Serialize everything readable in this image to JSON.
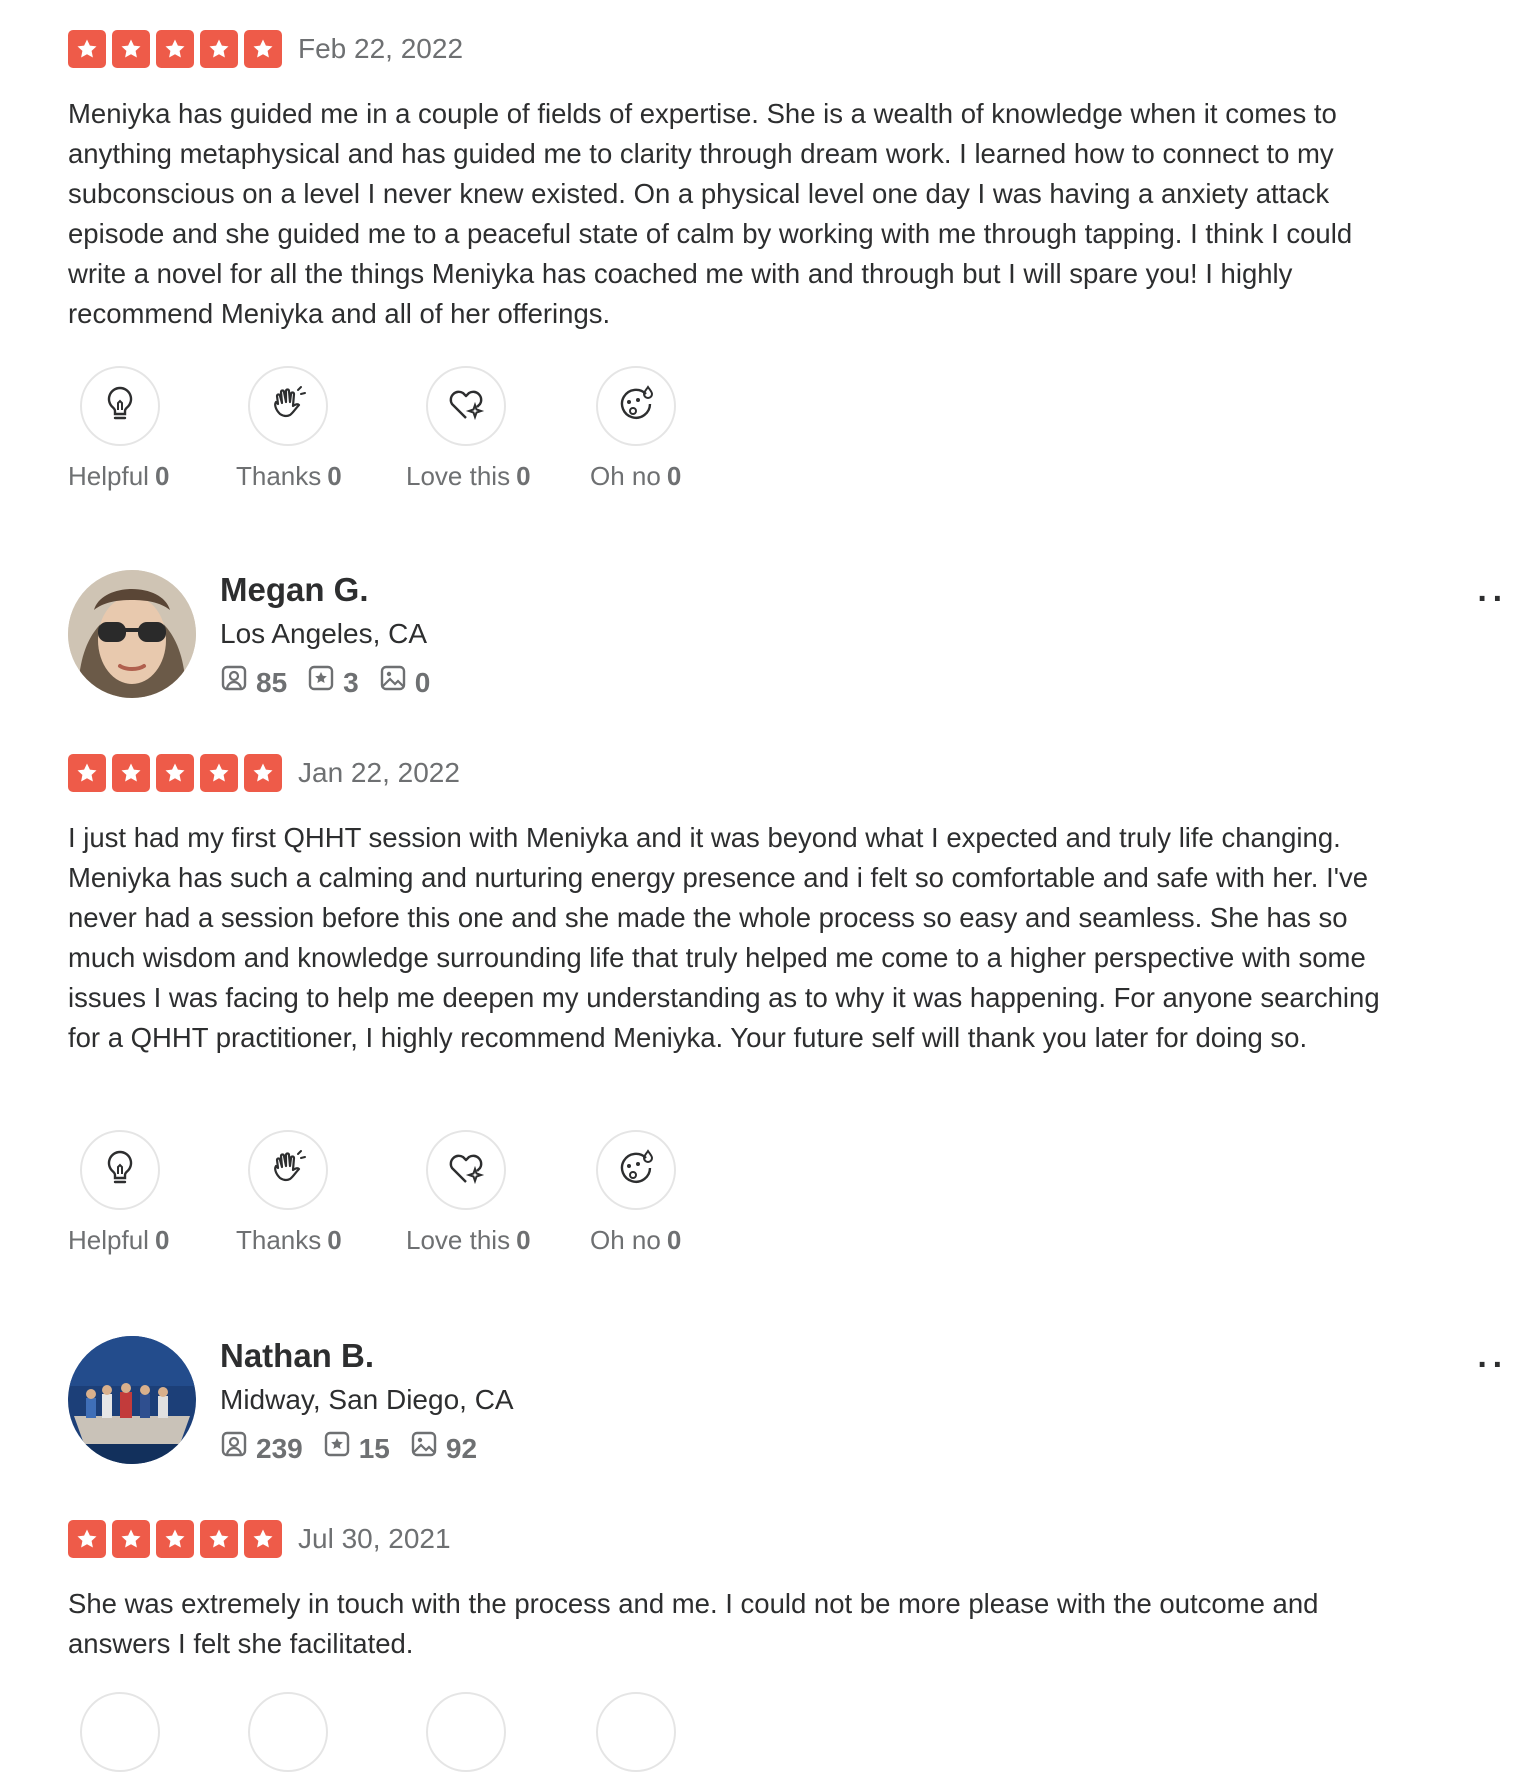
{
  "colors": {
    "star_red": "#ee5b49",
    "muted_text": "#6e7072",
    "body_text": "#2d2e2f",
    "circle_border": "#e5e5e5"
  },
  "reviews": [
    {
      "rating": 5,
      "date": "Feb 22, 2022",
      "text": "Meniyka has guided me in a couple of fields of expertise. She is a wealth of knowledge when it comes to anything metaphysical and has guided me to clarity through dream work. I learned how to connect to my subconscious on a level I never knew existed. On a physical level one day I was having a anxiety attack episode and she guided me to a peaceful state of calm by working with me through tapping. I think I could write a novel for all the things Meniyka has coached me with and through but I will spare you! I highly recommend Meniyka and all of her offerings.",
      "reactions": [
        {
          "label": "Helpful",
          "count": "0",
          "icon": "lightbulb-icon"
        },
        {
          "label": "Thanks",
          "count": "0",
          "icon": "wave-hand-icon"
        },
        {
          "label": "Love this",
          "count": "0",
          "icon": "heart-sparkle-icon"
        },
        {
          "label": "Oh no",
          "count": "0",
          "icon": "sad-face-icon"
        }
      ]
    },
    {
      "user": {
        "name": "Megan G.",
        "location": "Los Angeles, CA",
        "friends": "85",
        "reviews": "3",
        "photos": "0",
        "avatar": "avatar-sunglasses"
      },
      "more_label": "··",
      "rating": 5,
      "date": "Jan 22, 2022",
      "text": "I just had my first QHHT session with Meniyka and it was beyond what I expected and truly life changing. Meniyka has such a calming and nurturing energy presence and i felt so comfortable and safe with her. I've never had a session before this one and she made the whole process so easy and seamless. She has so much wisdom and knowledge surrounding life that truly helped me come to a higher perspective with some issues I was facing to help me deepen my understanding as to why it was happening. For anyone searching for a QHHT practitioner, I highly recommend Meniyka. Your future self will thank you later for doing so.",
      "reactions": [
        {
          "label": "Helpful",
          "count": "0",
          "icon": "lightbulb-icon"
        },
        {
          "label": "Thanks",
          "count": "0",
          "icon": "wave-hand-icon"
        },
        {
          "label": "Love this",
          "count": "0",
          "icon": "heart-sparkle-icon"
        },
        {
          "label": "Oh no",
          "count": "0",
          "icon": "sad-face-icon"
        }
      ]
    },
    {
      "user": {
        "name": "Nathan B.",
        "location": "Midway, San Diego, CA",
        "friends": "239",
        "reviews": "15",
        "photos": "92",
        "avatar": "avatar-boat-group"
      },
      "more_label": "··",
      "rating": 5,
      "date": "Jul 30, 2021",
      "text": "She was extremely in touch with the process and me. I could not be more please with the outcome and answers I felt she facilitated."
    }
  ]
}
